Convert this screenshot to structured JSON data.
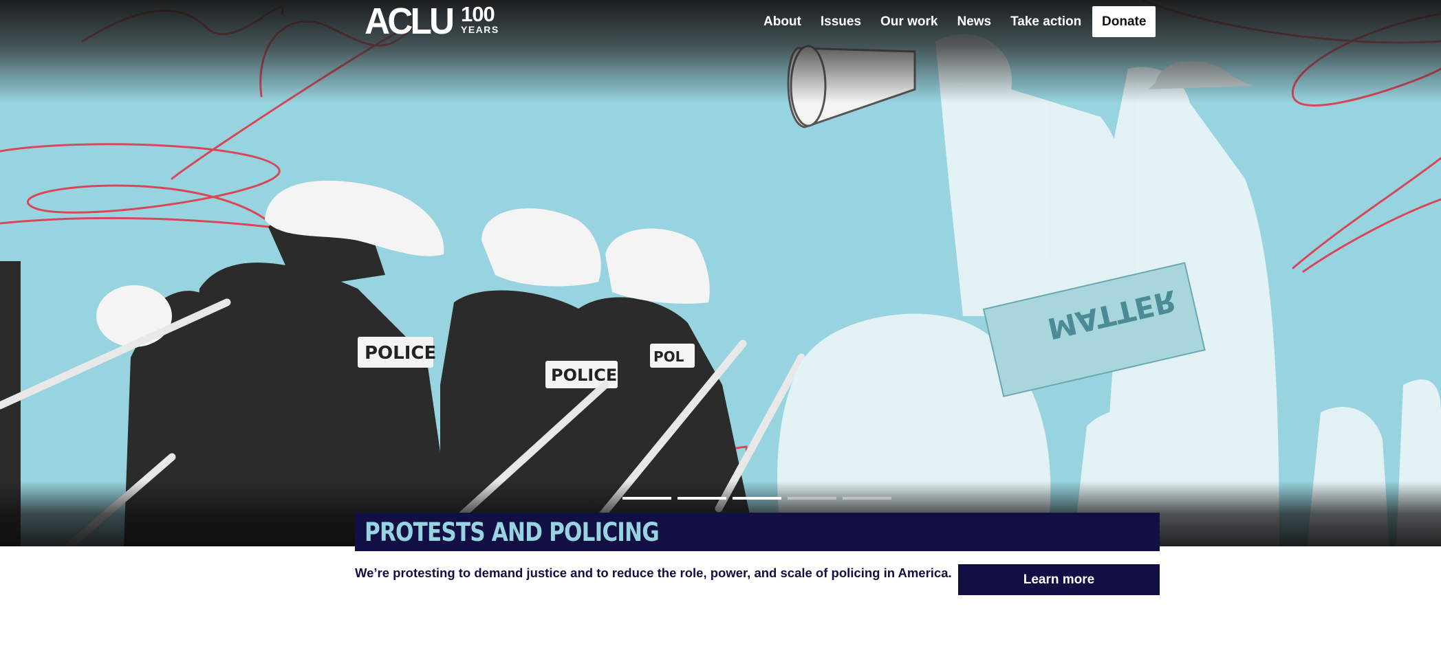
{
  "brand": {
    "logo_word": "ACLU",
    "logo_number": "100",
    "logo_sub": "YEARS"
  },
  "nav": {
    "items": [
      {
        "label": "About"
      },
      {
        "label": "Issues"
      },
      {
        "label": "Our work"
      },
      {
        "label": "News"
      },
      {
        "label": "Take action"
      }
    ],
    "donate_label": "Donate"
  },
  "hero": {
    "slide_indicators": {
      "count": 5,
      "active_through": 3
    },
    "signboard_text": "MATTER",
    "title": "PROTESTS AND POLICING",
    "description": "We’re protesting to demand justice and to reduce the role, power, and scale of policing in America.",
    "cta_label": "Learn more"
  },
  "colors": {
    "hero_bg": "#97d4df",
    "navy": "#120f45",
    "accent_red": "#e0384a",
    "white": "#ffffff"
  }
}
